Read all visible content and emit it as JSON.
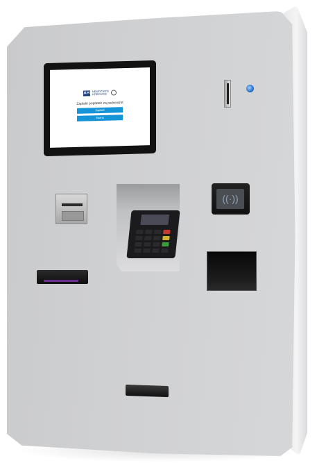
{
  "screen": {
    "logo_mark": "AH",
    "logo_text": "NEMOCNICE\nHOŘOVICE",
    "prompt": "Zaplatit poplatek za parkovizst",
    "button_primary": "Zaplatit",
    "button_secondary": "Storno"
  },
  "icons": {
    "nfc": "contactless-icon"
  },
  "colors": {
    "kiosk_body": "#cfd0d2",
    "screen_button": "#1694d8",
    "status_led": "#2a70c9",
    "bill_slot_light": "#6a2e8e"
  }
}
